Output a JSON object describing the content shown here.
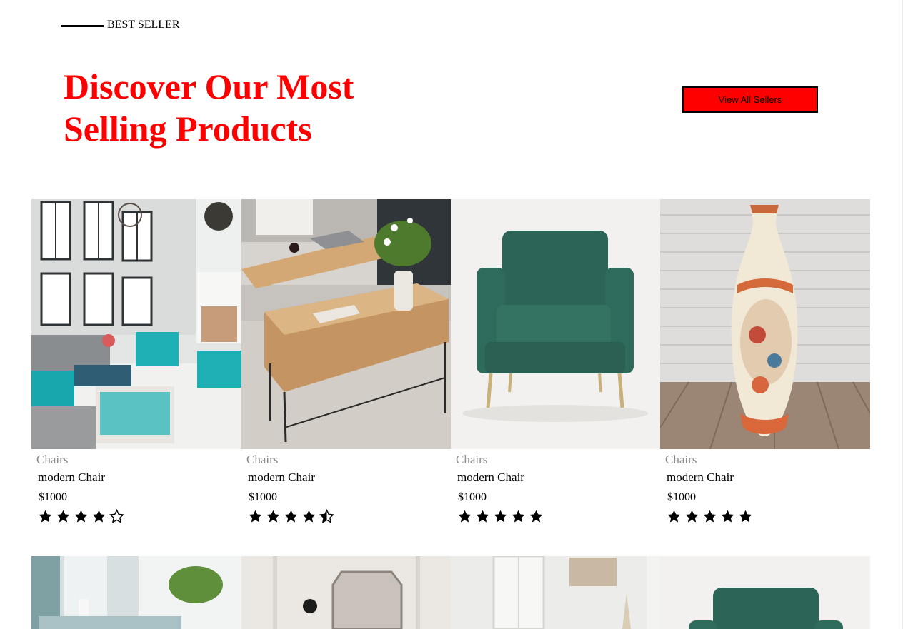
{
  "section": {
    "eyebrow": "BEST SELLER",
    "headline": "Discover Our Most Selling Products",
    "view_all_label": "View All Sellers",
    "accent_color": "#ff0000"
  },
  "products": [
    {
      "category": "Chairs",
      "name": "modern Chair",
      "price": "$1000",
      "rating": 4,
      "image": "living-room-teal-chairs"
    },
    {
      "category": "Chairs",
      "name": "modern Chair",
      "price": "$1000",
      "rating": 4.5,
      "image": "lift-top-coffee-table"
    },
    {
      "category": "Chairs",
      "name": "modern Chair",
      "price": "$1000",
      "rating": 5,
      "image": "green-velvet-armchair"
    },
    {
      "category": "Chairs",
      "name": "modern Chair",
      "price": "$1000",
      "rating": 5,
      "image": "floral-porcelain-vase"
    }
  ],
  "products_row2": [
    {
      "image": "bright-room-with-plant"
    },
    {
      "image": "white-panel-mirror"
    },
    {
      "image": "white-room-window"
    },
    {
      "image": "green-velvet-armchair"
    }
  ]
}
